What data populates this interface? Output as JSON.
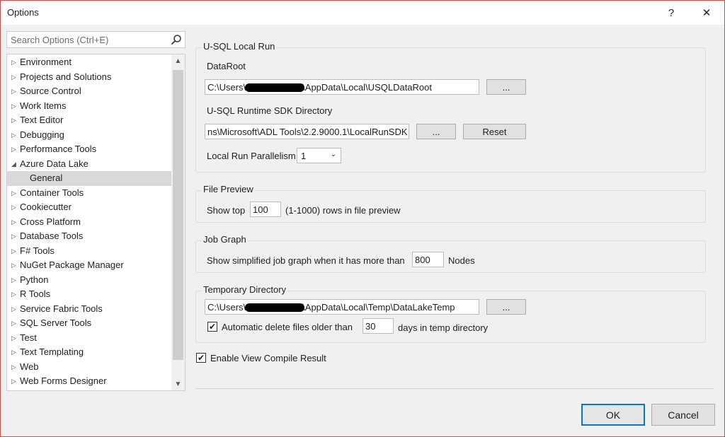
{
  "window": {
    "title": "Options",
    "help_label": "?",
    "close_label": "✕"
  },
  "search": {
    "placeholder": "Search Options (Ctrl+E)"
  },
  "tree": {
    "items": [
      {
        "label": "Environment",
        "arrow": "▷"
      },
      {
        "label": "Projects and Solutions",
        "arrow": "▷"
      },
      {
        "label": "Source Control",
        "arrow": "▷"
      },
      {
        "label": "Work Items",
        "arrow": "▷"
      },
      {
        "label": "Text Editor",
        "arrow": "▷"
      },
      {
        "label": "Debugging",
        "arrow": "▷"
      },
      {
        "label": "Performance Tools",
        "arrow": "▷"
      },
      {
        "label": "Azure Data Lake",
        "arrow": "◢"
      },
      {
        "label": "General",
        "arrow": ""
      },
      {
        "label": "Container Tools",
        "arrow": "▷"
      },
      {
        "label": "Cookiecutter",
        "arrow": "▷"
      },
      {
        "label": "Cross Platform",
        "arrow": "▷"
      },
      {
        "label": "Database Tools",
        "arrow": "▷"
      },
      {
        "label": "F# Tools",
        "arrow": "▷"
      },
      {
        "label": "NuGet Package Manager",
        "arrow": "▷"
      },
      {
        "label": "Python",
        "arrow": "▷"
      },
      {
        "label": "R Tools",
        "arrow": "▷"
      },
      {
        "label": "Service Fabric Tools",
        "arrow": "▷"
      },
      {
        "label": "SQL Server Tools",
        "arrow": "▷"
      },
      {
        "label": "Test",
        "arrow": "▷"
      },
      {
        "label": "Text Templating",
        "arrow": "▷"
      },
      {
        "label": "Web",
        "arrow": "▷"
      },
      {
        "label": "Web Forms Designer",
        "arrow": "▷"
      }
    ],
    "scroll_up": "▲",
    "scroll_down": "▼"
  },
  "usql": {
    "title": "U-SQL Local Run",
    "dataroot_label": "DataRoot",
    "dataroot_prefix": "C:\\Users\\",
    "dataroot_suffix": "\\AppData\\Local\\USQLDataRoot",
    "browse_label": "...",
    "sdk_label": "U-SQL Runtime SDK Directory",
    "sdk_value": "ns\\Microsoft\\ADL Tools\\2.2.9000.1\\LocalRunSDK",
    "sdk_browse_label": "...",
    "reset_label": "Reset",
    "parallelism_label": "Local Run Parallelism",
    "parallelism_value": "1"
  },
  "file_preview": {
    "title": "File Preview",
    "show_top_label": "Show top",
    "rows_value": "100",
    "rows_suffix": "(1-1000) rows in file preview"
  },
  "job_graph": {
    "title": "Job Graph",
    "label": "Show simplified job graph when it has more than",
    "nodes_value": "800",
    "nodes_suffix": "Nodes"
  },
  "temp_dir": {
    "title": "Temporary Directory",
    "path_prefix": "C:\\Users\\",
    "path_suffix": "\\AppData\\Local\\Temp\\DataLakeTemp",
    "browse_label": "...",
    "auto_delete_label": "Automatic delete files older than",
    "auto_delete_checked": "✔",
    "days_value": "30",
    "days_suffix": "days in temp directory"
  },
  "compile": {
    "label": "Enable View Compile Result",
    "checked": "✔"
  },
  "footer": {
    "ok_label": "OK",
    "cancel_label": "Cancel"
  },
  "colors": {
    "accent": "#0078d7",
    "window_border": "#e0443c",
    "selection": "#d9d9d9"
  }
}
